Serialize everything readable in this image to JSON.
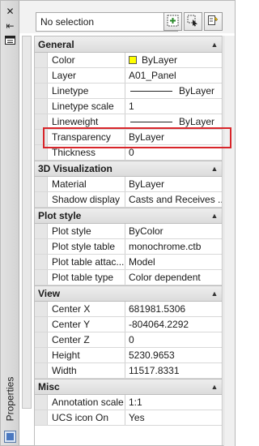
{
  "palette_title": "Properties",
  "top": {
    "selection_value": "No selection"
  },
  "sections": {
    "general": {
      "title": "General",
      "rows": [
        {
          "name": "Color",
          "value": "ByLayer"
        },
        {
          "name": "Layer",
          "value": "A01_Panel"
        },
        {
          "name": "Linetype",
          "value": "ByLayer"
        },
        {
          "name": "Linetype scale",
          "value": "1"
        },
        {
          "name": "Lineweight",
          "value": "ByLayer"
        },
        {
          "name": "Transparency",
          "value": "ByLayer"
        },
        {
          "name": "Thickness",
          "value": "0"
        }
      ]
    },
    "visualization": {
      "title": "3D Visualization",
      "rows": [
        {
          "name": "Material",
          "value": "ByLayer"
        },
        {
          "name": "Shadow display",
          "value": "Casts and Receives ..."
        }
      ]
    },
    "plot": {
      "title": "Plot style",
      "rows": [
        {
          "name": "Plot style",
          "value": "ByColor"
        },
        {
          "name": "Plot style table",
          "value": "monochrome.ctb"
        },
        {
          "name": "Plot table attac...",
          "value": "Model"
        },
        {
          "name": "Plot table type",
          "value": "Color dependent"
        }
      ]
    },
    "view": {
      "title": "View",
      "rows": [
        {
          "name": "Center X",
          "value": "681981.5306"
        },
        {
          "name": "Center Y",
          "value": "-804064.2292"
        },
        {
          "name": "Center Z",
          "value": "0"
        },
        {
          "name": "Height",
          "value": "5230.9653"
        },
        {
          "name": "Width",
          "value": "11517.8331"
        }
      ]
    },
    "misc": {
      "title": "Misc",
      "rows": [
        {
          "name": "Annotation scale",
          "value": "1:1"
        },
        {
          "name": "UCS icon On",
          "value": "Yes"
        }
      ]
    }
  },
  "colors": {
    "highlight": "#d8252a",
    "color_swatch": "#ffff00",
    "header_bg": "#dcdcdc"
  },
  "icons": {
    "close": "close-icon",
    "autohide": "autohide-icon",
    "menu": "properties-menu-icon",
    "quick_select": "quick-select-icon",
    "select_objects": "select-objects-icon",
    "pickadd": "pickadd-toggle-icon"
  }
}
